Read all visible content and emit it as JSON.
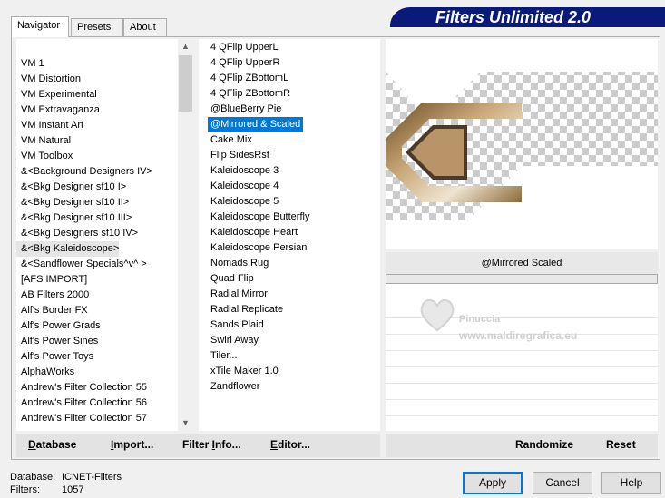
{
  "app": {
    "title": "Filters Unlimited 2.0"
  },
  "tabs": [
    {
      "label": "Navigator",
      "active": true
    },
    {
      "label": "Presets",
      "active": false
    },
    {
      "label": "About",
      "active": false
    }
  ],
  "categories": {
    "items": [
      "VM 1",
      "VM Distortion",
      "VM Experimental",
      "VM Extravaganza",
      "VM Instant Art",
      "VM Natural",
      "VM Toolbox",
      "&<Background Designers IV>",
      "&<Bkg Designer sf10 I>",
      "&<Bkg Designer sf10 II>",
      "&<Bkg Designer sf10 III>",
      "&<Bkg Designers sf10 IV>",
      "&<Bkg Kaleidoscope>",
      "&<Sandflower Specials^v^ >",
      "[AFS IMPORT]",
      "AB Filters 2000",
      "Alf's Border FX",
      "Alf's Power Grads",
      "Alf's Power Sines",
      "Alf's Power Toys",
      "AlphaWorks",
      "Andrew's Filter Collection 55",
      "Andrew's Filter Collection 56",
      "Andrew's Filter Collection 57"
    ],
    "selected_index": 12
  },
  "filters": {
    "items": [
      "4 QFlip UpperL",
      "4 QFlip UpperR",
      "4 QFlip ZBottomL",
      "4 QFlip ZBottomR",
      "@BlueBerry Pie",
      "@Mirrored & Scaled",
      "Cake Mix",
      "Flip SidesRsf",
      "Kaleidoscope 3",
      "Kaleidoscope 4",
      "Kaleidoscope 5",
      "Kaleidoscope Butterfly",
      "Kaleidoscope Heart",
      "Kaleidoscope Persian",
      "Nomads Rug",
      "Quad Flip",
      "Radial Mirror",
      "Radial Replicate",
      "Sands Plaid",
      "Swirl Away",
      "Tiler...",
      "xTile Maker 1.0",
      "Zandflower"
    ],
    "selected_index": 5
  },
  "preview": {
    "filter_name": "@Mirrored  Scaled"
  },
  "watermark": {
    "line1": "Pinuccia",
    "line2": "www.maldiregrafica.eu"
  },
  "bottom_left": {
    "database": {
      "pre": "",
      "ul": "D",
      "post": "atabase"
    },
    "import": {
      "pre": "",
      "ul": "I",
      "post": "mport..."
    },
    "filter_info": {
      "pre": "Filter ",
      "ul": "I",
      "post": "nfo..."
    },
    "editor": {
      "pre": "",
      "ul": "E",
      "post": "ditor..."
    }
  },
  "bottom_right": {
    "randomize": "Randomize",
    "reset": "Reset"
  },
  "status": {
    "database_label": "Database:",
    "database_value": "ICNET-Filters",
    "filters_label": "Filters:",
    "filters_value": "1057"
  },
  "buttons": {
    "apply": "Apply",
    "cancel": "Cancel",
    "help": "Help"
  },
  "colors": {
    "banner": "#0a1a7a",
    "selection": "#0078d7"
  }
}
